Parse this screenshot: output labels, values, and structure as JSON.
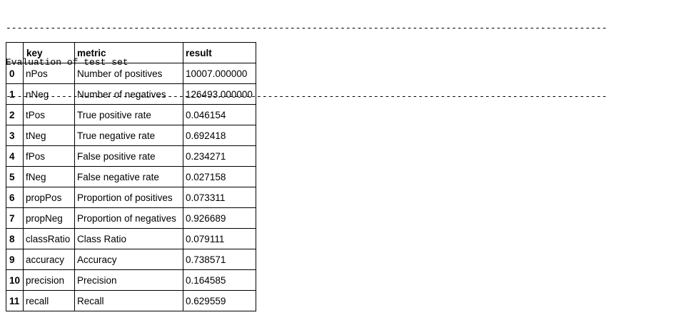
{
  "output": {
    "rule_top": "------------------------------------------------------------------------------------------------------------",
    "title": "Evaluation of test set",
    "rule_bottom": "------------------------------------------------------------------------------------------------------------"
  },
  "table": {
    "columns": [
      "",
      "key",
      "metric",
      "result"
    ],
    "rows": [
      {
        "index": "0",
        "key": "nPos",
        "metric": "Number of positives",
        "result": "10007.000000"
      },
      {
        "index": "1",
        "key": "nNeg",
        "metric": "Number of negatives",
        "result": "126493.000000"
      },
      {
        "index": "2",
        "key": "tPos",
        "metric": "True positive rate",
        "result": "0.046154"
      },
      {
        "index": "3",
        "key": "tNeg",
        "metric": "True negative rate",
        "result": "0.692418"
      },
      {
        "index": "4",
        "key": "fPos",
        "metric": "False positive rate",
        "result": "0.234271"
      },
      {
        "index": "5",
        "key": "fNeg",
        "metric": "False negative rate",
        "result": "0.027158"
      },
      {
        "index": "6",
        "key": "propPos",
        "metric": "Proportion of positives",
        "result": "0.073311"
      },
      {
        "index": "7",
        "key": "propNeg",
        "metric": "Proportion of negatives",
        "result": "0.926689"
      },
      {
        "index": "8",
        "key": "classRatio",
        "metric": "Class Ratio",
        "result": "0.079111"
      },
      {
        "index": "9",
        "key": "accuracy",
        "metric": "Accuracy",
        "result": "0.738571"
      },
      {
        "index": "10",
        "key": "precision",
        "metric": "Precision",
        "result": "0.164585"
      },
      {
        "index": "11",
        "key": "recall",
        "metric": "Recall",
        "result": "0.629559"
      }
    ]
  }
}
